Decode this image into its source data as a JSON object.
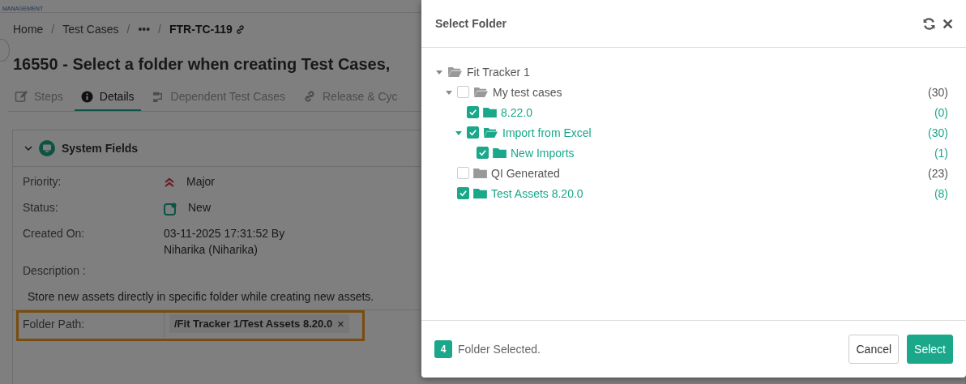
{
  "logo": {
    "text": "MANAGEMENT"
  },
  "breadcrumb": [
    {
      "label": "Home"
    },
    {
      "separator": "/",
      "label": "Test Cases"
    },
    {
      "separator": "/",
      "label": "•••"
    },
    {
      "separator": "/",
      "label": "FTR-TC-119"
    }
  ],
  "title": "16550 - Select a folder when creating Test Cases,",
  "tabs": [
    {
      "label": "Steps",
      "kind": "edit",
      "selected": false
    },
    {
      "label": "Details",
      "kind": "info",
      "selected": true
    },
    {
      "label": "Dependent Test Cases",
      "kind": "flow",
      "selected": false
    },
    {
      "label": "Release & Cyc",
      "kind": "link",
      "selected": false
    }
  ],
  "section": {
    "title": "System Fields",
    "expanded": true
  },
  "fields": [
    {
      "kind": "priority",
      "label": "Priority:",
      "value_lines": [
        "Major"
      ]
    },
    {
      "kind": "status",
      "label": "Status:",
      "value_lines": [
        "New"
      ]
    },
    {
      "kind": "text",
      "label": "Created On:",
      "value_lines": [
        "03-11-2025 17:31:52 By",
        "Niharika (Niharika)"
      ]
    }
  ],
  "description": {
    "label": "Description :",
    "text": "Store new assets directly in specific folder while creating new assets."
  },
  "folder_path": {
    "label": "Folder Path:",
    "tag": "/Fit Tracker 1/Test Assets 8.20.0",
    "remove": "×",
    "highlighted": true
  },
  "dialog": {
    "title": "Select Folder",
    "tree": [
      {
        "label": "Fit Tracker 1",
        "expanded": true,
        "children": [
          {
            "label": "My test cases",
            "count": "(30)",
            "checked": false,
            "expanded": true,
            "children": [
              {
                "label": "8.22.0",
                "count": "(0)",
                "checked": true
              },
              {
                "label": "Import from Excel",
                "count": "(30)",
                "checked": true,
                "expanded": true,
                "children": [
                  {
                    "label": "New Imports",
                    "count": "(1)",
                    "checked": true
                  }
                ]
              }
            ]
          },
          {
            "label": "QI Generated",
            "count": "(23)",
            "checked": false
          },
          {
            "label": "Test Assets 8.20.0",
            "count": "(8)",
            "checked": true
          }
        ]
      }
    ],
    "selected_count": "4",
    "selected_text": "Folder Selected.",
    "buttons": [
      {
        "kind": "secondary",
        "label": "Cancel"
      },
      {
        "kind": "primary",
        "label": "Select"
      }
    ]
  }
}
